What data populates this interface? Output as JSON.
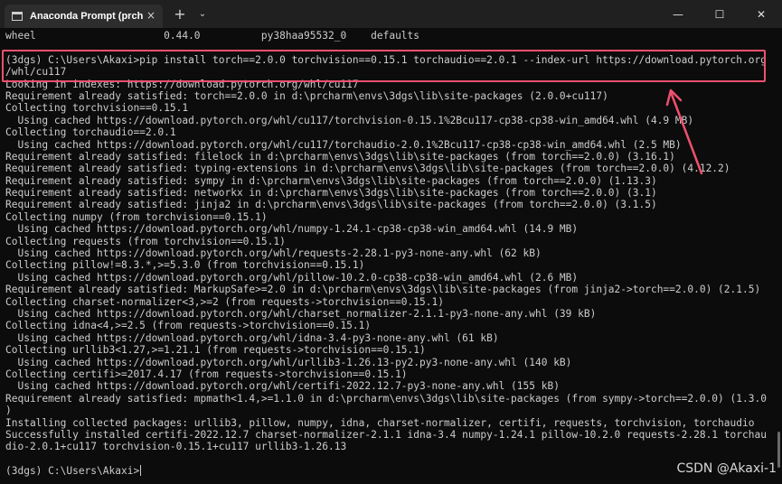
{
  "window": {
    "tab_title": "Anaconda Prompt (prcharm)",
    "tab_close": "×",
    "new_tab": "+",
    "dropdown": "⌄",
    "minimize": "—",
    "maximize": "☐",
    "close": "✕"
  },
  "terminal": {
    "lines": [
      "wheel                     0.44.0          py38haa95532_0    defaults",
      "",
      "(3dgs) C:\\Users\\Akaxi>pip install torch==2.0.0 torchvision==0.15.1 torchaudio==2.0.1 --index-url https://download.pytorch.org",
      "/whl/cu117",
      "Looking in indexes: https://download.pytorch.org/whl/cu117",
      "Requirement already satisfied: torch==2.0.0 in d:\\prcharm\\envs\\3dgs\\lib\\site-packages (2.0.0+cu117)",
      "Collecting torchvision==0.15.1",
      "  Using cached https://download.pytorch.org/whl/cu117/torchvision-0.15.1%2Bcu117-cp38-cp38-win_amd64.whl (4.9 MB)",
      "Collecting torchaudio==2.0.1",
      "  Using cached https://download.pytorch.org/whl/cu117/torchaudio-2.0.1%2Bcu117-cp38-cp38-win_amd64.whl (2.5 MB)",
      "Requirement already satisfied: filelock in d:\\prcharm\\envs\\3dgs\\lib\\site-packages (from torch==2.0.0) (3.16.1)",
      "Requirement already satisfied: typing-extensions in d:\\prcharm\\envs\\3dgs\\lib\\site-packages (from torch==2.0.0) (4.12.2)",
      "Requirement already satisfied: sympy in d:\\prcharm\\envs\\3dgs\\lib\\site-packages (from torch==2.0.0) (1.13.3)",
      "Requirement already satisfied: networkx in d:\\prcharm\\envs\\3dgs\\lib\\site-packages (from torch==2.0.0) (3.1)",
      "Requirement already satisfied: jinja2 in d:\\prcharm\\envs\\3dgs\\lib\\site-packages (from torch==2.0.0) (3.1.5)",
      "Collecting numpy (from torchvision==0.15.1)",
      "  Using cached https://download.pytorch.org/whl/numpy-1.24.1-cp38-cp38-win_amd64.whl (14.9 MB)",
      "Collecting requests (from torchvision==0.15.1)",
      "  Using cached https://download.pytorch.org/whl/requests-2.28.1-py3-none-any.whl (62 kB)",
      "Collecting pillow!=8.3.*,>=5.3.0 (from torchvision==0.15.1)",
      "  Using cached https://download.pytorch.org/whl/pillow-10.2.0-cp38-cp38-win_amd64.whl (2.6 MB)",
      "Requirement already satisfied: MarkupSafe>=2.0 in d:\\prcharm\\envs\\3dgs\\lib\\site-packages (from jinja2->torch==2.0.0) (2.1.5)",
      "Collecting charset-normalizer<3,>=2 (from requests->torchvision==0.15.1)",
      "  Using cached https://download.pytorch.org/whl/charset_normalizer-2.1.1-py3-none-any.whl (39 kB)",
      "Collecting idna<4,>=2.5 (from requests->torchvision==0.15.1)",
      "  Using cached https://download.pytorch.org/whl/idna-3.4-py3-none-any.whl (61 kB)",
      "Collecting urllib3<1.27,>=1.21.1 (from requests->torchvision==0.15.1)",
      "  Using cached https://download.pytorch.org/whl/urllib3-1.26.13-py2.py3-none-any.whl (140 kB)",
      "Collecting certifi>=2017.4.17 (from requests->torchvision==0.15.1)",
      "  Using cached https://download.pytorch.org/whl/certifi-2022.12.7-py3-none-any.whl (155 kB)",
      "Requirement already satisfied: mpmath<1.4,>=1.1.0 in d:\\prcharm\\envs\\3dgs\\lib\\site-packages (from sympy->torch==2.0.0) (1.3.0",
      ")",
      "Installing collected packages: urllib3, pillow, numpy, idna, charset-normalizer, certifi, requests, torchvision, torchaudio",
      "Successfully installed certifi-2022.12.7 charset-normalizer-2.1.1 idna-3.4 numpy-1.24.1 pillow-10.2.0 requests-2.28.1 torchau",
      "dio-2.0.1+cu117 torchvision-0.15.1+cu117 urllib3-1.26.13",
      ""
    ],
    "prompt": "(3dgs) C:\\Users\\Akaxi>"
  },
  "watermark": "CSDN @Akaxi-1",
  "colors": {
    "background": "#0c0c0c",
    "text": "#cccccc",
    "titlebar": "#202020",
    "annotation": "#f0506e"
  },
  "icons": {
    "tab_icon": "terminal-icon",
    "new_tab": "plus-icon",
    "dropdown": "chevron-down-icon",
    "minimize": "minimize-icon",
    "maximize": "maximize-icon",
    "close": "close-icon"
  }
}
